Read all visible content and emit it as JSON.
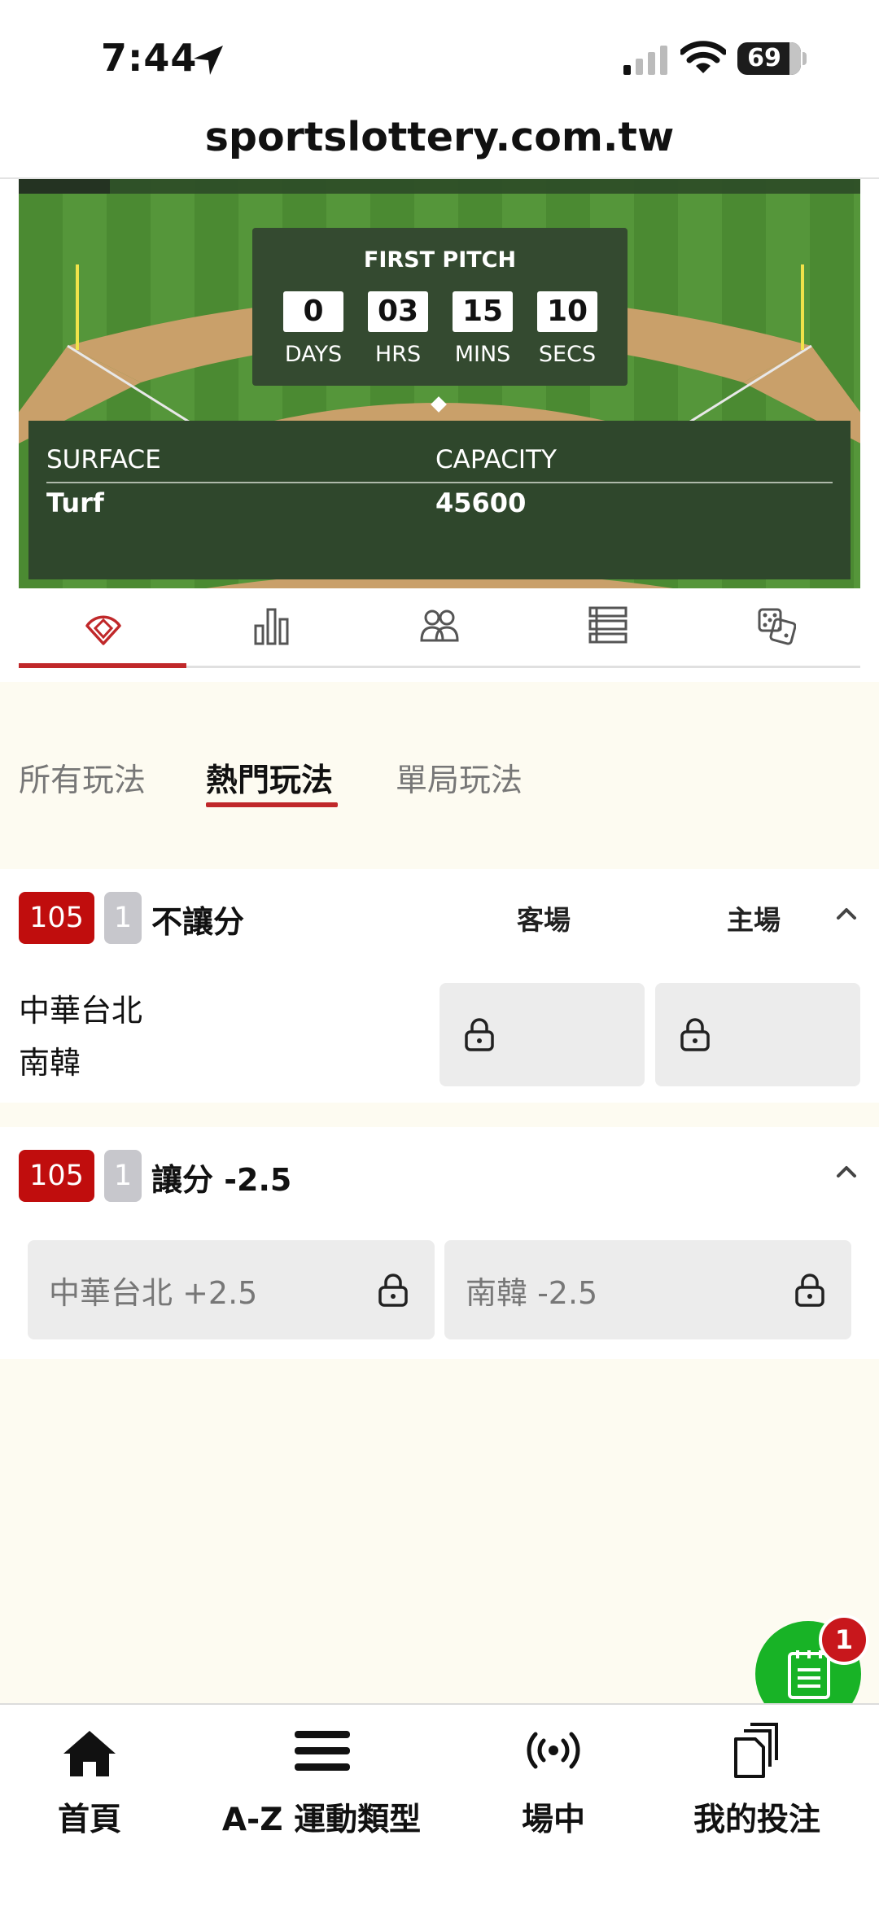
{
  "status_bar": {
    "time": "7:44",
    "battery": "69"
  },
  "browser": {
    "url": "sportslottery.com.tw"
  },
  "hero": {
    "countdown_title": "FIRST PITCH",
    "countdown": [
      {
        "value": "0",
        "label": "DAYS"
      },
      {
        "value": "03",
        "label": "HRS"
      },
      {
        "value": "15",
        "label": "MINS"
      },
      {
        "value": "10",
        "label": "SECS"
      }
    ],
    "surface_label": "SURFACE",
    "surface_value": "Turf",
    "capacity_label": "CAPACITY",
    "capacity_value": "45600"
  },
  "icon_tabs": [
    "baseball-field-icon",
    "stats-bars-icon",
    "players-icon",
    "list-icon",
    "dice-icon"
  ],
  "play_tabs": [
    {
      "label": "所有玩法"
    },
    {
      "label": "熱門玩法"
    },
    {
      "label": "單局玩法"
    }
  ],
  "markets": [
    {
      "code": "105",
      "num": "1",
      "title": "不讓分",
      "away_header": "客場",
      "home_header": "主場",
      "team_away": "中華台北",
      "team_home": "南韓"
    },
    {
      "code": "105",
      "num": "1",
      "title": "讓分 -2.5",
      "option_1": "中華台北 +2.5",
      "option_2": "南韓 -2.5"
    }
  ],
  "bet_slip": {
    "count": "1"
  },
  "bottom_nav": [
    {
      "label": "首頁"
    },
    {
      "label": "A-Z 運動類型"
    },
    {
      "label": "場中"
    },
    {
      "label": "我的投注"
    }
  ],
  "colors": {
    "accent_red": "#c0282a",
    "badge_red": "#c00d0d",
    "fab_green": "#18b326",
    "field_green": "#4b8a32"
  }
}
